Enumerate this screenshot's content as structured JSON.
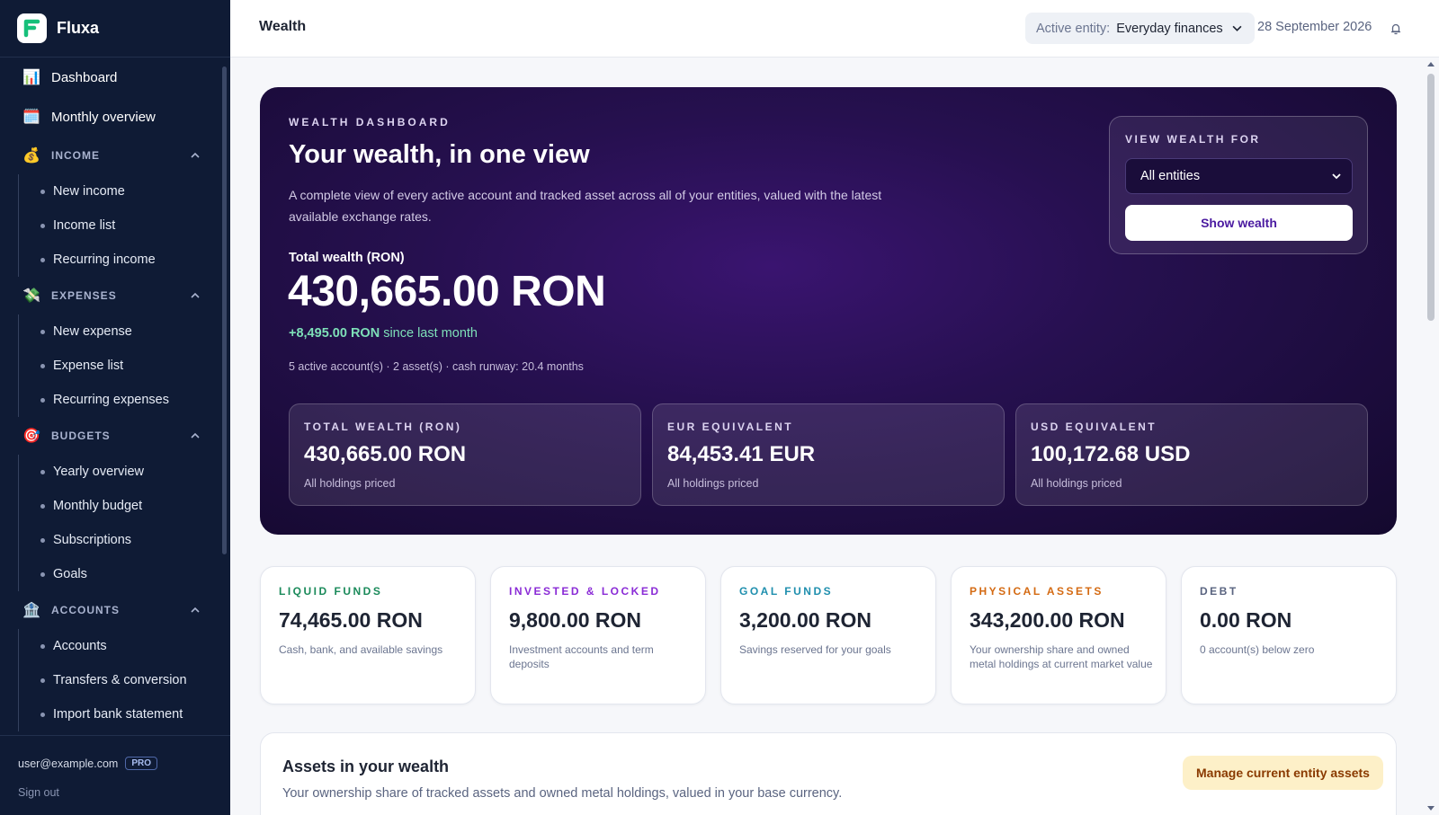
{
  "app": {
    "name": "Fluxa"
  },
  "sidebar": {
    "top_items": [
      {
        "label": "Dashboard",
        "icon": "bar-chart-icon"
      },
      {
        "label": "Monthly overview",
        "icon": "calendar-icon"
      }
    ],
    "sections": [
      {
        "title": "INCOME",
        "icon": "money-bag-icon",
        "items": [
          "New income",
          "Income list",
          "Recurring income"
        ]
      },
      {
        "title": "EXPENSES",
        "icon": "money-wings-icon",
        "items": [
          "New expense",
          "Expense list",
          "Recurring expenses"
        ]
      },
      {
        "title": "BUDGETS",
        "icon": "target-icon",
        "items": [
          "Yearly overview",
          "Monthly budget",
          "Subscriptions",
          "Goals"
        ]
      },
      {
        "title": "ACCOUNTS",
        "icon": "bank-icon",
        "items": [
          "Accounts",
          "Transfers & conversion",
          "Import bank statement"
        ]
      }
    ],
    "footer": {
      "user": "user@example.com",
      "badge": "PRO",
      "signout": "Sign out"
    }
  },
  "topbar": {
    "title": "Wealth",
    "entity_label": "Active entity:",
    "entity_value": "Everyday finances",
    "date": "28 September 2026"
  },
  "hero": {
    "eyebrow": "WEALTH DASHBOARD",
    "title": "Your wealth, in one view",
    "description": "A complete view of every active account and tracked asset across all of your entities, valued with the latest available exchange rates.",
    "total_label": "Total wealth (RON)",
    "total_value": "430,665.00 RON",
    "change_amount": "+8,495.00 RON",
    "change_suffix": "since last month",
    "meta": "5 active account(s) · 2 asset(s) · cash runway: 20.4 months",
    "stats": [
      {
        "label": "TOTAL WEALTH (RON)",
        "value": "430,665.00 RON",
        "note": "All holdings priced"
      },
      {
        "label": "EUR EQUIVALENT",
        "value": "84,453.41 EUR",
        "note": "All holdings priced"
      },
      {
        "label": "USD EQUIVALENT",
        "value": "100,172.68 USD",
        "note": "All holdings priced"
      }
    ],
    "panel": {
      "label": "VIEW WEALTH FOR",
      "select_value": "All entities",
      "button": "Show wealth"
    }
  },
  "cards": [
    {
      "label": "LIQUID FUNDS",
      "value": "74,465.00 RON",
      "desc": "Cash, bank, and available savings",
      "color": "#1a8a5a"
    },
    {
      "label": "INVESTED & LOCKED",
      "value": "9,800.00 RON",
      "desc": "Investment accounts and term deposits",
      "color": "#8a2bd6"
    },
    {
      "label": "GOAL FUNDS",
      "value": "3,200.00 RON",
      "desc": "Savings reserved for your goals",
      "color": "#1f8fae"
    },
    {
      "label": "PHYSICAL ASSETS",
      "value": "343,200.00 RON",
      "desc": "Your ownership share and owned metal holdings at current market value",
      "color": "#d46a12"
    },
    {
      "label": "DEBT",
      "value": "0.00 RON",
      "desc": "0 account(s) below zero",
      "color": "#5a6480"
    }
  ],
  "assets": {
    "title": "Assets in your wealth",
    "desc": "Your ownership share of tracked assets and owned metal holdings, valued in your base currency.",
    "button": "Manage current entity assets"
  }
}
